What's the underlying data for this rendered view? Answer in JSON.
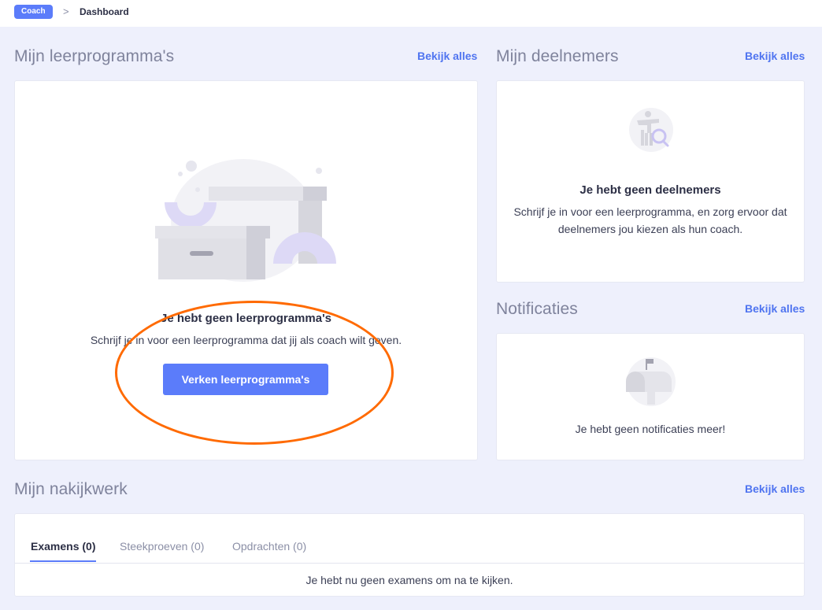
{
  "breadcrumb": {
    "role_badge": "Coach",
    "separator": ">",
    "current": "Dashboard"
  },
  "programs": {
    "title": "Mijn leerprogramma's",
    "view_all": "Bekijk alles",
    "empty_title": "Je hebt geen leerprogramma's",
    "empty_text": "Schrijf je in voor een leerprogramma dat jij als coach wilt geven.",
    "cta_label": "Verken leerprogramma's",
    "illustration_icon": "empty-boxes-icon"
  },
  "participants": {
    "title": "Mijn deelnemers",
    "view_all": "Bekijk alles",
    "empty_title": "Je hebt geen deelnemers",
    "empty_text": "Schrijf je in voor een leerprogramma, en zorg ervoor dat deelnemers jou kiezen als hun coach.",
    "illustration_icon": "person-search-icon"
  },
  "notifications": {
    "title": "Notificaties",
    "view_all": "Bekijk alles",
    "empty_text": "Je hebt geen notificaties meer!",
    "illustration_icon": "mailbox-icon"
  },
  "grading": {
    "title": "Mijn nakijkwerk",
    "view_all": "Bekijk alles",
    "tabs": [
      {
        "label": "Examens (0)",
        "active": true
      },
      {
        "label": "Steekproeven (0)",
        "active": false
      },
      {
        "label": "Opdrachten (0)",
        "active": false
      }
    ],
    "empty_text": "Je hebt nu geen examens om na te kijken."
  },
  "colors": {
    "accent": "#5b7cfa",
    "link": "#4f74f0",
    "background": "#eef0fc",
    "highlight_annotation": "#ff6a00"
  }
}
